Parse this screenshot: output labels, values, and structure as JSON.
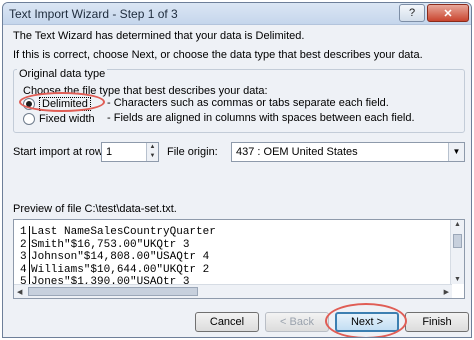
{
  "window": {
    "title": "Text Import Wizard - Step 1 of 3",
    "help_label": "?",
    "close_label": "✕"
  },
  "intro": {
    "line1": "The Text Wizard has determined that your data is Delimited.",
    "line2": "If this is correct, choose Next, or choose the data type that best describes your data."
  },
  "original_data_type": {
    "group_label": "Original data type",
    "prompt": "Choose the file type that best describes your data:",
    "options": [
      {
        "label": "Delimited",
        "description": "- Characters such as commas or tabs separate each field.",
        "selected": true
      },
      {
        "label": "Fixed width",
        "description": "- Fields are aligned in columns with spaces between each field.",
        "selected": false
      }
    ]
  },
  "start_import": {
    "label": "Start import at row:",
    "value": "1"
  },
  "file_origin": {
    "label": "File origin:",
    "value": "437 : OEM United States"
  },
  "preview": {
    "label": "Preview of file C:\\test\\data-set.txt.",
    "lines": [
      {
        "num": "1",
        "text": "Last NameSalesCountryQuarter"
      },
      {
        "num": "2",
        "text": "Smith\"$16,753.00\"UKQtr 3"
      },
      {
        "num": "3",
        "text": "Johnson\"$14,808.00\"USAQtr 4"
      },
      {
        "num": "4",
        "text": "Williams\"$10,644.00\"UKQtr 2"
      },
      {
        "num": "5",
        "text": "Jones\"$1,390.00\"USAQtr 3"
      }
    ]
  },
  "buttons": {
    "cancel": "Cancel",
    "back": "< Back",
    "next": "Next >",
    "finish": "Finish"
  },
  "colors": {
    "highlight": "#e05d55",
    "default_button_border": "#3c7fb1"
  }
}
